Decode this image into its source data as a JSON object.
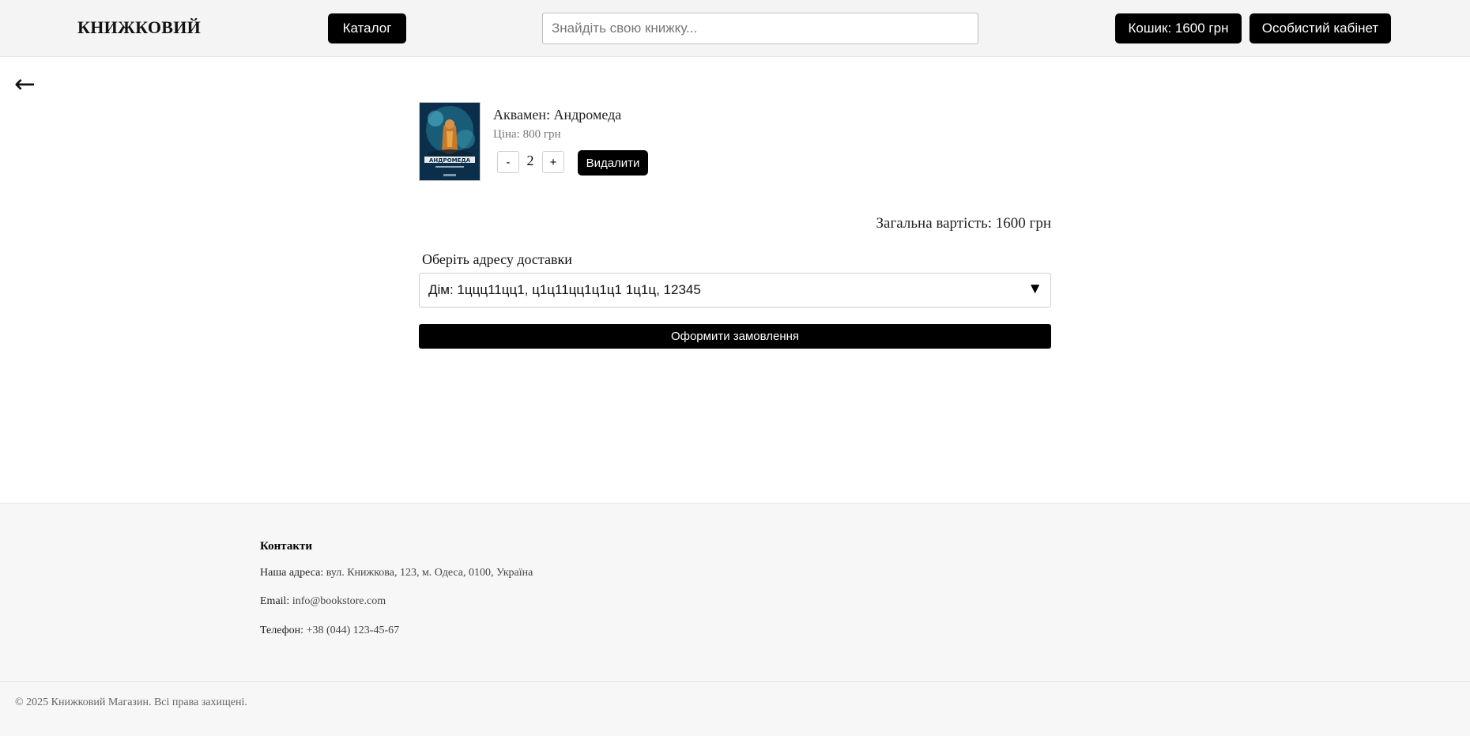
{
  "header": {
    "logo": "КНИЖКОВИЙ",
    "catalog_label": "Каталог",
    "search_placeholder": "Знайдіть свою книжку...",
    "cart_label": "Кошик: 1600 грн",
    "account_label": "Особистий кабінет"
  },
  "nav": {
    "back_arrow": "←"
  },
  "cart": {
    "items": [
      {
        "title": "Аквамен: Андромеда",
        "price": "Ціна: 800 грн",
        "quantity": "2",
        "minus_label": "-",
        "plus_label": "+",
        "remove_label": "Видалити",
        "cover_text": "АНДРОМЕДА"
      }
    ],
    "total": "Загальна вартість: 1600 грн",
    "address_label": "Оберіть адресу доставки",
    "address_selected": "Дім: 1ццц11цц1, ц1ц11цц1ц1ц1 1ц1ц, 12345",
    "order_label": "Оформити замовлення"
  },
  "footer": {
    "contacts_title": "Контакти",
    "address_label": "Наша адреса:",
    "address_value": "вул. Книжкова, 123, м. Одеса, 0100, Україна",
    "email_label": "Email:",
    "email_value": "info@bookstore.com",
    "phone_label": "Телефон:",
    "phone_value": "+38 (044) 123-45-67",
    "copyright": "© 2025 Книжковий Магазин. Всі права захищені."
  },
  "icons": {
    "back": "arrow-left-icon",
    "dropdown": "caret-down-icon"
  }
}
